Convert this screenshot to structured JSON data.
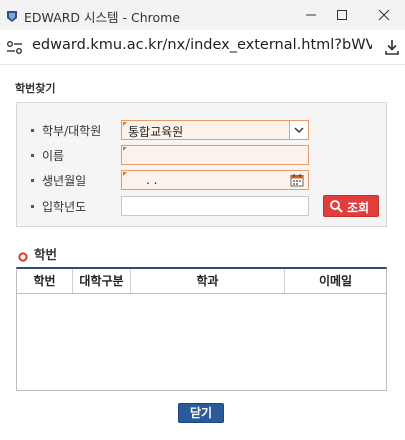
{
  "window": {
    "title": "EDWARD 시스템 - Chrome",
    "app_icon": "edward-app-icon",
    "controls": [
      "minimize-icon",
      "maximize-icon",
      "close-icon"
    ]
  },
  "addressbar": {
    "url": "edward.kmu.ac.kr/nx/index_external.html?bWVud...",
    "site_icon": "site-settings-icon",
    "download_icon": "download-icon"
  },
  "page": {
    "title": "학번찾기"
  },
  "form": {
    "dept_label": "학부/대학원",
    "dept_value": "통합교육원",
    "name_label": "이름",
    "name_value": "",
    "birth_label": "생년월일",
    "birth_value": ". .",
    "year_label": "입학년도",
    "year_value": "",
    "search_button": "조회"
  },
  "results": {
    "title": "학번",
    "columns": [
      "학번",
      "대학구분",
      "학과",
      "이메일"
    ],
    "rows": []
  },
  "footer": {
    "close_button": "닫기"
  },
  "colors": {
    "required_border": "#e89a6a",
    "search_button": "#e23d3d",
    "close_button": "#2b5a9a",
    "grid_header_line": "#2a4b86"
  }
}
